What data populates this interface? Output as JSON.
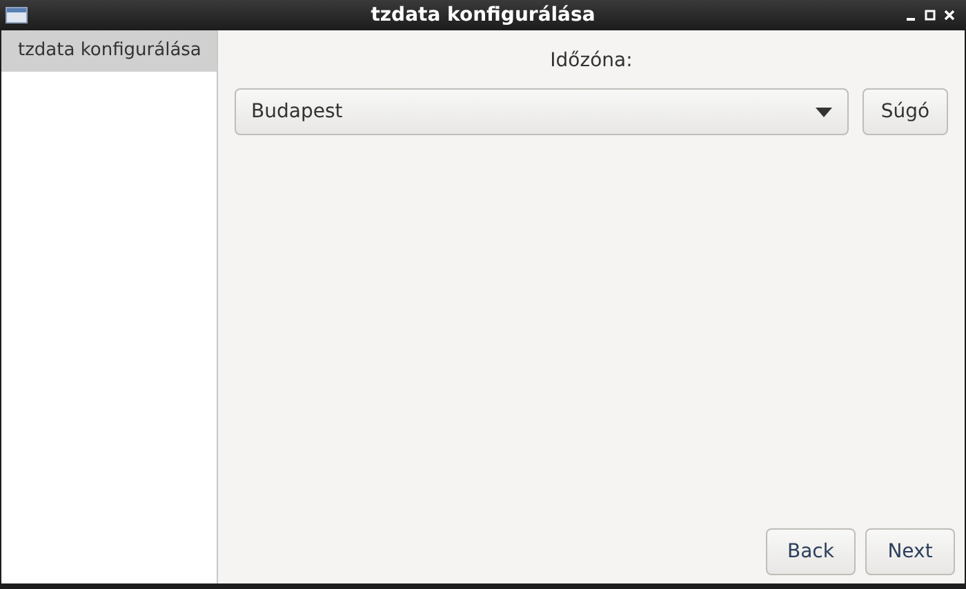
{
  "window": {
    "title": "tzdata konfigurálása"
  },
  "sidebar": {
    "items": [
      {
        "label": "tzdata konfigurálása",
        "selected": true
      }
    ]
  },
  "timezone": {
    "label": "Időzóna:",
    "value": "Budapest"
  },
  "help_button": "Súgó",
  "buttons": [
    "Back",
    "Next"
  ]
}
